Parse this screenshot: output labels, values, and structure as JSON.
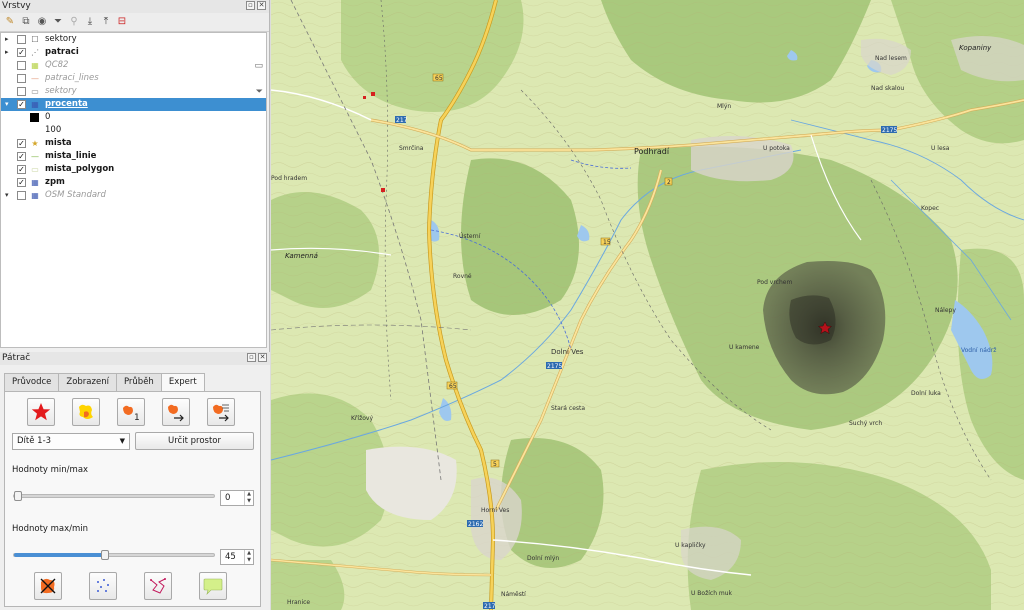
{
  "layers_panel": {
    "title": "Vrstvy",
    "items": [
      {
        "label": "sektory",
        "checked": false,
        "style": "normal",
        "expand": "▸"
      },
      {
        "label": "patraci",
        "checked": true,
        "style": "bold",
        "expand": "▸"
      },
      {
        "label": "QC82",
        "checked": false,
        "style": "gray",
        "expand": ""
      },
      {
        "label": "patraci_lines",
        "checked": false,
        "style": "gray",
        "expand": ""
      },
      {
        "label": "sektory",
        "checked": false,
        "style": "gray",
        "expand": ""
      },
      {
        "label": "procenta",
        "checked": true,
        "style": "selected",
        "expand": "▾"
      },
      {
        "label": "mista",
        "checked": true,
        "style": "bold",
        "expand": ""
      },
      {
        "label": "mista_linie",
        "checked": true,
        "style": "bold",
        "expand": ""
      },
      {
        "label": "mista_polygon",
        "checked": true,
        "style": "bold",
        "expand": ""
      },
      {
        "label": "zpm",
        "checked": true,
        "style": "bold",
        "expand": ""
      },
      {
        "label": "OSM Standard",
        "checked": false,
        "style": "gray",
        "expand": "▾"
      }
    ],
    "legend": {
      "min": "0",
      "max": "100"
    }
  },
  "patrac_panel": {
    "title": "Pátrač",
    "tabs": [
      "Průvodce",
      "Zobrazení",
      "Průběh",
      "Expert"
    ],
    "active_tab": "Expert",
    "combo_value": "Dítě 1-3",
    "button_label": "Určit prostor",
    "minmax_label": "Hodnoty min/max",
    "minmax_value": "0",
    "minmax_fraction": 0.0,
    "maxmin_label": "Hodnoty max/min",
    "maxmin_value": "45",
    "maxmin_fraction": 0.45
  },
  "map": {
    "labels": {
      "podhradi": "Podhradí",
      "kamenna": "Kamenná",
      "kopaniny": "Kopaniny",
      "vodni_nadrz": "Vodní nádrž",
      "smrcina": "Smrčina",
      "usterni": "Ústerní",
      "mlyn": "Mlýn",
      "suchy_vrch": "Suchý vrch",
      "hranice": "Hranice",
      "nad_lesem": "Nad lesem",
      "u_lesa": "U lesa",
      "pod_vrchem": "Pod vrchem",
      "u_potoka": "U potoka",
      "u_kamene": "U kamene",
      "dolni_luka": "Dolní luka",
      "nalepy": "Nálepy",
      "nad_skalou": "Nad skalou",
      "rovne": "Rovné",
      "krizovy": "Křížový",
      "dolni_ves": "Dolní Ves",
      "horni_ves": "Horní Ves",
      "u_kapliky": "U kapličky",
      "namesti": "Náměstí",
      "dolni_mlyn": "Dolní mlýn",
      "u_bozich": "U Božích muk",
      "pod_hradem": "Pod hradem",
      "stara_cesta": "Stará cesta",
      "kopec": "Kopec"
    },
    "roads": [
      "217",
      "65",
      "2175",
      "15",
      "2",
      "5",
      "2162",
      "2175",
      "217",
      "65"
    ]
  },
  "colors": {
    "selection": "#3d8fd1",
    "map_bg": "#dfe9b7",
    "forest": "#b6d28a",
    "road": "#f3c64a",
    "water": "#9fc7ec"
  }
}
